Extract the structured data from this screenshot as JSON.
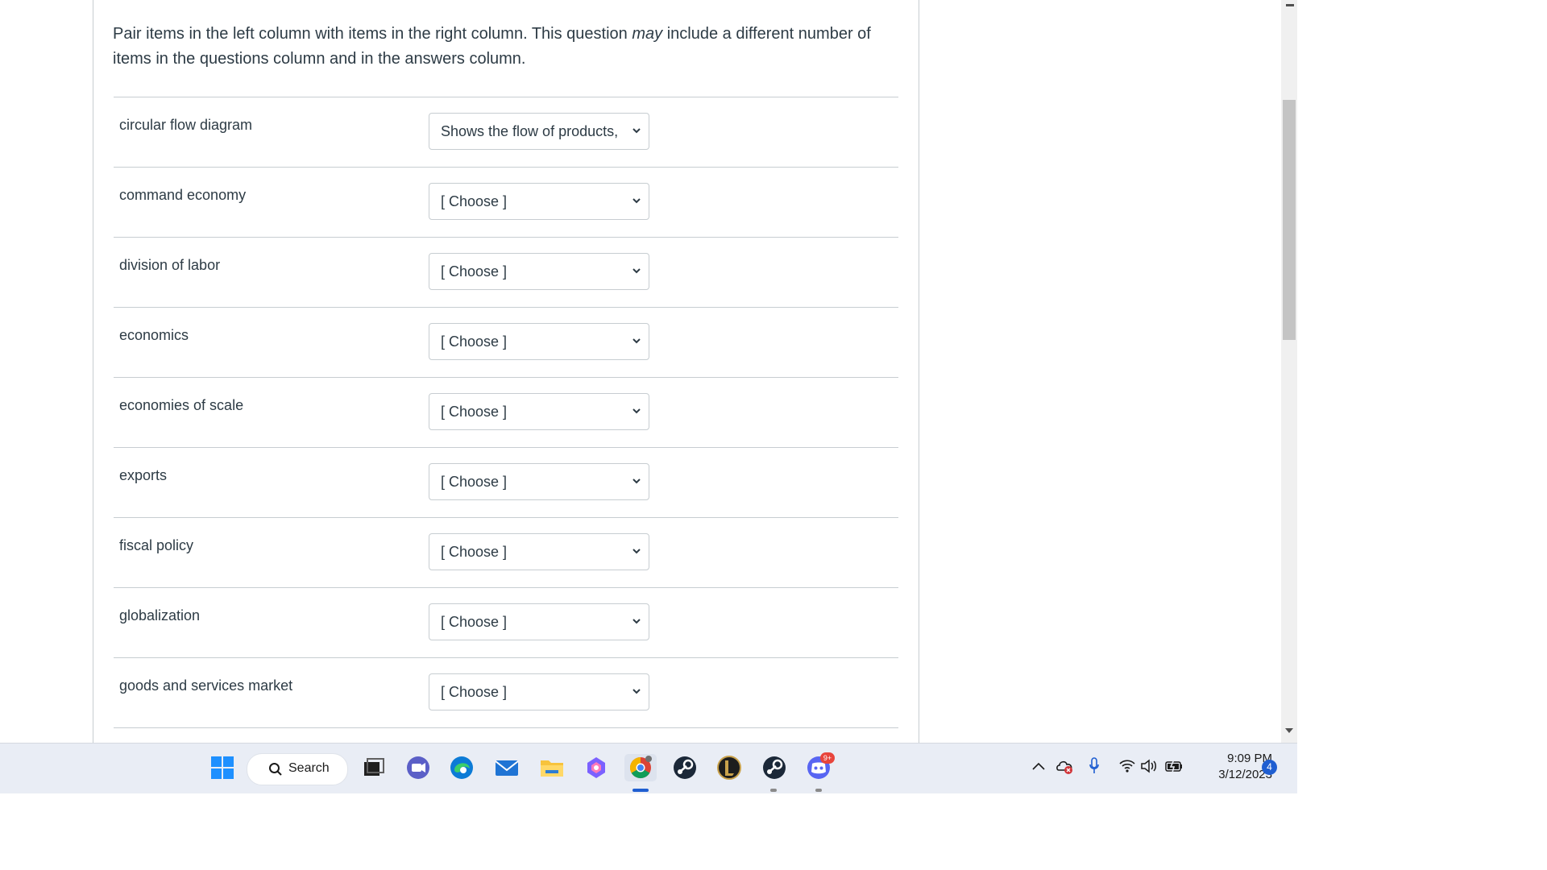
{
  "question": {
    "text_before": "Pair items in the left column with items in the right column. This question ",
    "text_emphasis": "may",
    "text_after": " include a different number of items in the questions column and in the answers column."
  },
  "pairs": [
    {
      "term": "circular flow diagram",
      "selected": "Shows the flow of products, r"
    },
    {
      "term": "command economy",
      "selected": "[ Choose ]"
    },
    {
      "term": "division of labor",
      "selected": "[ Choose ]"
    },
    {
      "term": "economics",
      "selected": "[ Choose ]"
    },
    {
      "term": "economies of scale",
      "selected": "[ Choose ]"
    },
    {
      "term": "exports",
      "selected": "[ Choose ]"
    },
    {
      "term": "fiscal policy",
      "selected": "[ Choose ]"
    },
    {
      "term": "globalization",
      "selected": "[ Choose ]"
    },
    {
      "term": "goods and services market",
      "selected": "[ Choose ]"
    }
  ],
  "taskbar": {
    "search_label": "Search",
    "apps": [
      "windows-start",
      "task-view",
      "teams-chat",
      "edge",
      "mail",
      "file-explorer",
      "copilot",
      "chrome",
      "steam",
      "league-of-legends",
      "steam",
      "discord"
    ],
    "discord_badge": "9+",
    "clock_time": "9:09 PM",
    "clock_date": "3/12/2023",
    "notification_count": "4"
  },
  "colors": {
    "text": "#2d3b45",
    "border": "#c7cdd1",
    "taskbar_bg": "#e9edf5",
    "accent_blue": "#1f5ed1"
  }
}
